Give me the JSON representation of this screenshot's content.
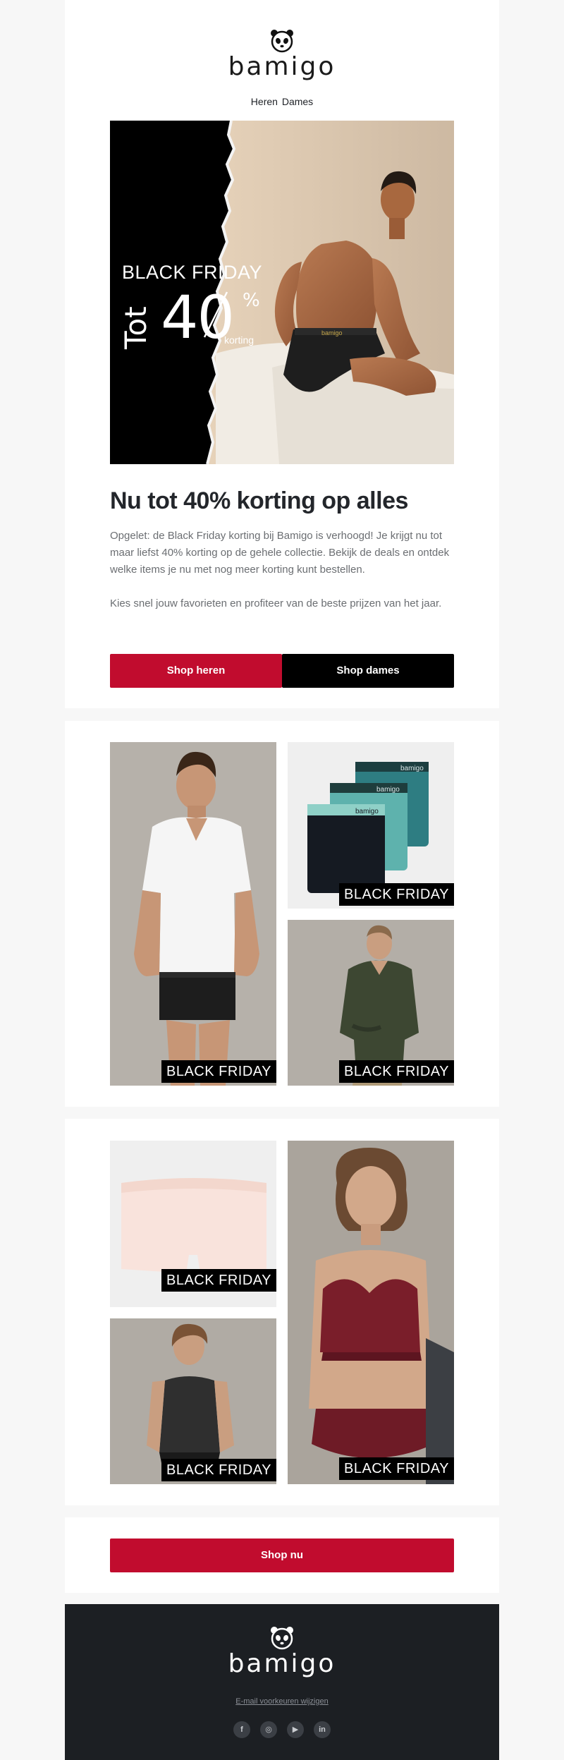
{
  "brand": {
    "name": "bamigo",
    "accent": "#c10c2e",
    "dark": "#1c1f23"
  },
  "nav": {
    "heren": "Heren",
    "dames": "Dames"
  },
  "hero": {
    "banner": {
      "black_friday": "BLACK FRIDAY",
      "tot": "Tot",
      "number": "40",
      "percent": "%",
      "korting": "korting"
    },
    "headline": "Nu tot 40% korting op alles",
    "paragraph1": "Opgelet: de Black Friday korting bij Bamigo is verhoogd! Je krijgt nu tot maar liefst 40% korting op de gehele collectie. Bekijk de deals en ontdek welke items je nu met nog meer korting kunt bestellen.",
    "paragraph2": "Kies snel jouw favorieten en profiteer van de beste prijzen van het jaar.",
    "btn_heren": "Shop heren",
    "btn_dames": "Shop dames"
  },
  "grid1": {
    "tile_tshirt": {
      "badge": "BLACK FRIDAY",
      "icon": "man-white-tshirt-image"
    },
    "tile_boxers": {
      "badge": "BLACK FRIDAY",
      "icon": "boxer-shorts-image",
      "waistband_text": "bamigo"
    },
    "tile_sweater": {
      "badge": "BLACK FRIDAY",
      "icon": "man-green-sweater-image"
    }
  },
  "grid2": {
    "tile_shorts": {
      "badge": "BLACK FRIDAY",
      "icon": "pink-shorts-image"
    },
    "tile_tank": {
      "badge": "BLACK FRIDAY",
      "icon": "woman-tank-top-image"
    },
    "tile_bra": {
      "badge": "BLACK FRIDAY",
      "icon": "woman-bra-image"
    }
  },
  "shop_nu": "Shop nu",
  "footer": {
    "logo": "bamigo",
    "preferences_link": "E-mail voorkeuren wijzigen",
    "socials": [
      {
        "name": "facebook-icon",
        "glyph": "f"
      },
      {
        "name": "instagram-icon",
        "glyph": "◎"
      },
      {
        "name": "youtube-icon",
        "glyph": "▶"
      },
      {
        "name": "linkedin-icon",
        "glyph": "in"
      }
    ]
  }
}
